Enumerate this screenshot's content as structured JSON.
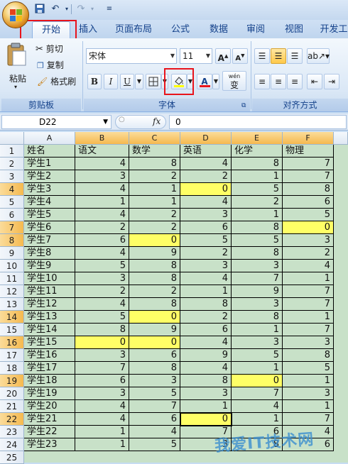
{
  "tabs": [
    {
      "label": "开始",
      "active": true
    },
    {
      "label": "插入"
    },
    {
      "label": "页面布局"
    },
    {
      "label": "公式"
    },
    {
      "label": "数据"
    },
    {
      "label": "审阅"
    },
    {
      "label": "视图"
    },
    {
      "label": "开发工"
    }
  ],
  "ribbon": {
    "clipboard": {
      "paste": "粘贴",
      "cut": "剪切",
      "copy": "复制",
      "format_painter": "格式刷",
      "group": "剪贴板"
    },
    "font": {
      "name": "宋体",
      "size": "11",
      "bold": "B",
      "italic": "I",
      "underline": "U",
      "font_color": "A",
      "wen": "wén",
      "wen_char": "变",
      "group": "字体"
    },
    "align": {
      "group": "对齐方式"
    }
  },
  "formula_bar": {
    "name_box": "D22",
    "fx": "fx",
    "value": "0"
  },
  "columns": [
    "A",
    "B",
    "C",
    "D",
    "E",
    "F"
  ],
  "header_row": [
    "姓名",
    "语文",
    "数学",
    "英语",
    "化学",
    "物理"
  ],
  "rows": [
    [
      "学生1",
      "4",
      "8",
      "4",
      "8",
      "7"
    ],
    [
      "学生2",
      "3",
      "2",
      "2",
      "1",
      "7"
    ],
    [
      "学生3",
      "4",
      "1",
      "0",
      "5",
      "8"
    ],
    [
      "学生4",
      "1",
      "1",
      "4",
      "2",
      "6"
    ],
    [
      "学生5",
      "4",
      "2",
      "3",
      "1",
      "5"
    ],
    [
      "学生6",
      "2",
      "2",
      "6",
      "8",
      "0"
    ],
    [
      "学生7",
      "6",
      "0",
      "5",
      "5",
      "3"
    ],
    [
      "学生8",
      "4",
      "9",
      "2",
      "8",
      "2"
    ],
    [
      "学生9",
      "5",
      "8",
      "3",
      "3",
      "4"
    ],
    [
      "学生10",
      "3",
      "8",
      "4",
      "7",
      "1"
    ],
    [
      "学生11",
      "2",
      "2",
      "1",
      "9",
      "7"
    ],
    [
      "学生12",
      "4",
      "8",
      "8",
      "3",
      "7"
    ],
    [
      "学生13",
      "5",
      "0",
      "2",
      "8",
      "1"
    ],
    [
      "学生14",
      "8",
      "9",
      "6",
      "1",
      "7"
    ],
    [
      "学生15",
      "0",
      "0",
      "4",
      "3",
      "3"
    ],
    [
      "学生16",
      "3",
      "6",
      "9",
      "5",
      "8"
    ],
    [
      "学生17",
      "7",
      "8",
      "4",
      "1",
      "5"
    ],
    [
      "学生18",
      "6",
      "3",
      "8",
      "0",
      "1"
    ],
    [
      "学生19",
      "3",
      "5",
      "3",
      "7",
      "3"
    ],
    [
      "学生20",
      "4",
      "7",
      "1",
      "4",
      "1"
    ],
    [
      "学生21",
      "4",
      "6",
      "0",
      "1",
      "7"
    ],
    [
      "学生22",
      "1",
      "4",
      "7",
      "6",
      "4"
    ],
    [
      "学生23",
      "1",
      "5",
      "3",
      "8",
      "6"
    ]
  ],
  "extra_row_number": "25",
  "watermark": "我爱IT技术网",
  "colors": {
    "highlight": "#ffff66",
    "selection_header": "#f5b94f",
    "sheet_bg": "#c8e1c8",
    "annotation": "#e8141c"
  }
}
